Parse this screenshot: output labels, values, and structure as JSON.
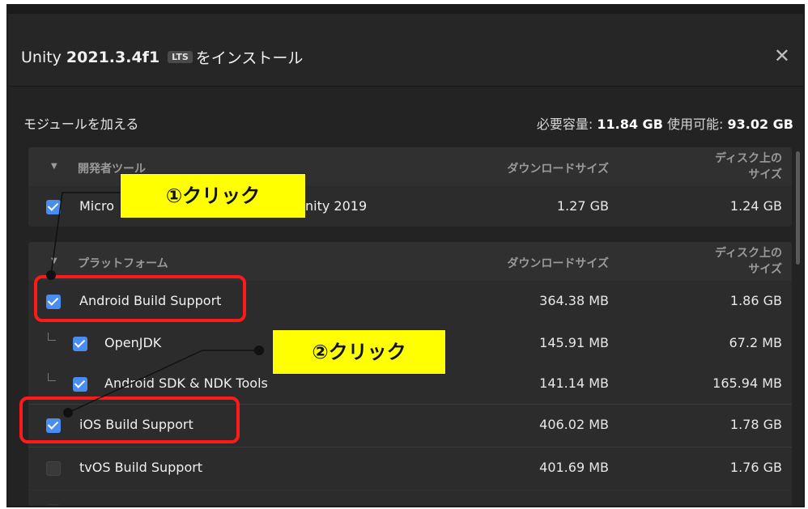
{
  "window": {
    "title_prefix": "Unity",
    "version": "2021.3.4f1",
    "lts_badge": "LTS",
    "title_suffix": "をインストール",
    "close_glyph": "✕"
  },
  "modules": {
    "label": "モジュールを加える",
    "required_label": "必要容量:",
    "required_value": "11.84 GB",
    "available_label": "使用可能:",
    "available_value": "93.02 GB"
  },
  "sections": {
    "dev_tools": {
      "header": "開発者ツール",
      "col_download": "ダウンロードサイズ",
      "col_disk_line1": "ディスク上の",
      "col_disk_line2": "サイズ",
      "rows": [
        {
          "label_start": "Micro",
          "label_end": "nity 2019",
          "download": "1.27 GB",
          "disk": "1.24 GB",
          "checked": true
        }
      ]
    },
    "platforms": {
      "header": "プラットフォーム",
      "col_download": "ダウンロードサイズ",
      "col_disk_line1": "ディスク上の",
      "col_disk_line2": "サイズ",
      "rows": [
        {
          "label": "Android Build Support",
          "download": "364.38 MB",
          "disk": "1.86 GB",
          "checked": true
        },
        {
          "label": "OpenJDK",
          "download": "145.91 MB",
          "disk": "67.2 MB",
          "checked": true
        },
        {
          "label": "Android SDK & NDK Tools",
          "download": "141.14 MB",
          "disk": "165.94 MB",
          "checked": true
        },
        {
          "label": "iOS Build Support",
          "download": "406.02 MB",
          "disk": "1.78 GB",
          "checked": true
        },
        {
          "label": "tvOS Build Support",
          "download": "401.69 MB",
          "disk": "1.76 GB",
          "checked": false
        }
      ]
    }
  },
  "annotations": {
    "callout1": "①クリック",
    "callout2": "②クリック"
  },
  "colors": {
    "checkbox_on": "#4b8cf0",
    "highlight": "#ff1a1a",
    "callout_bg": "#ffff00"
  }
}
